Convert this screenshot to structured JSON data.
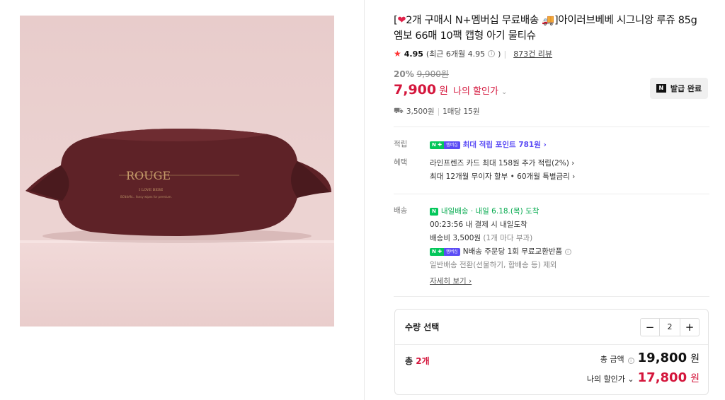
{
  "product": {
    "title_prefix": "[",
    "title_heart": "❤",
    "title_main": "2개 구매시 N+멤버십 무료배송 🚚]아이러브베베 시그니앙 루쥬 85g 엠보 66매 10팩 캡형 아기 물티슈",
    "image_brand": "ROUGE",
    "image_line1": "I LOVE BEBE",
    "image_line2": "BCN4AN... fancy wipes for premium."
  },
  "rating": {
    "star": "★",
    "score": "4.95",
    "recent": "(최근 6개월 4.95",
    "recent_close": ")",
    "info": "i",
    "reviews": "873건 리뷰"
  },
  "price": {
    "discount_pct": "20%",
    "original": "9,900원",
    "current": "7,900",
    "currency": "원",
    "my_discount": "나의 할인가",
    "chevron": "⌄",
    "coupon_icon": "N",
    "coupon_label": "발급 완료"
  },
  "shipping_summary": {
    "truck": "⛟",
    "fee": "3,500원",
    "per": "1매당 15원"
  },
  "benefits": {
    "point_label": "적립",
    "npay_n": "N ✚",
    "npay_m": "멤버십",
    "point_text": "최대 적립 포인트 781원 ›",
    "benefit_label": "혜택",
    "benefit1": "라인프렌즈 카드 최대 158원 추가 적립(2%) ›",
    "benefit2": "최대 12개월 무이자 할부 • 60개월 특별금리 ›"
  },
  "delivery": {
    "label": "배송",
    "badge": "내일배송",
    "arrival": "· 내일 6.18.(목) 도착",
    "countdown": "00:23:56  내 결제 시 내일도착",
    "fee_line": "배송비 3,500원",
    "fee_note": "(1개 마다 부과)",
    "return_text": "N배송 주문당 1회 무료교환반품",
    "info": "i",
    "exclude": "일반배송 전환(선물하기, 합배송 등) 제외",
    "detail_link": "자세히 보기 ›"
  },
  "quantity": {
    "title": "수량 선택",
    "minus": "−",
    "value": "2",
    "plus": "+",
    "count_prefix": "총",
    "count_value": "2개",
    "total_label": "총 금액",
    "total_info": "i",
    "total_amount": "19,800",
    "total_currency": "원",
    "discount_label": "나의 할인가 ⌄",
    "discount_amount": "17,800",
    "discount_currency": "원"
  }
}
